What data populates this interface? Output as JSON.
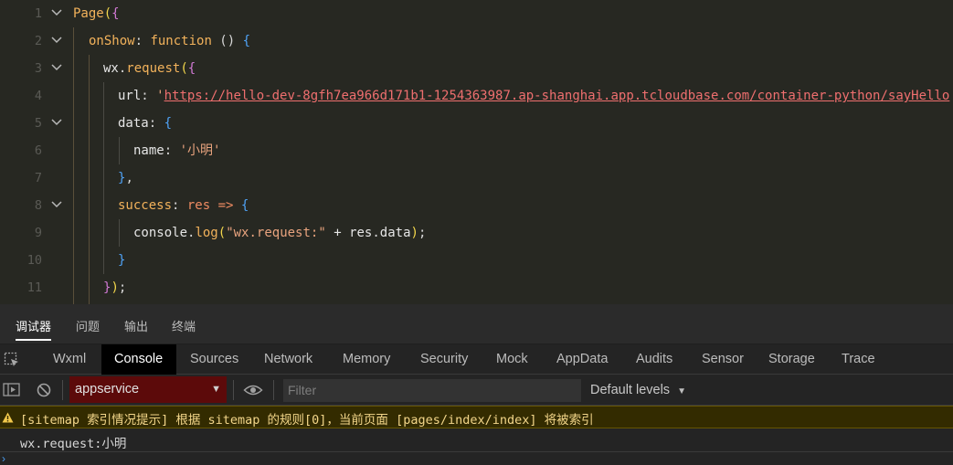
{
  "editor": {
    "lines": [
      {
        "n": "1",
        "tokens": [
          [
            "Page",
            "t-call"
          ],
          [
            "(",
            "t-brace-y"
          ],
          [
            "{",
            "t-brace-p"
          ]
        ]
      },
      {
        "n": "2",
        "tokens": [
          [
            "onShow",
            "t-prop"
          ],
          [
            ": ",
            "t-punc"
          ],
          [
            "function",
            "t-fn"
          ],
          [
            " () ",
            "t-punc"
          ],
          [
            "{",
            "t-brace-b"
          ]
        ]
      },
      {
        "n": "3",
        "tokens": [
          [
            "wx",
            "t-white"
          ],
          [
            ".",
            "t-punc"
          ],
          [
            "request",
            "t-call"
          ],
          [
            "(",
            "t-brace-y"
          ],
          [
            "{",
            "t-brace-p"
          ]
        ]
      },
      {
        "n": "4",
        "tokens": [
          [
            "url",
            "t-white"
          ],
          [
            ": ",
            "t-punc"
          ],
          [
            "'",
            "t-str"
          ],
          [
            "https://hello-dev-8gfh7ea966d171b1-1254363987.ap-shanghai.app.tcloudbase.com/container-python/sayHello",
            "t-url"
          ],
          [
            "'",
            "t-str"
          ],
          [
            ",",
            "t-punc"
          ]
        ]
      },
      {
        "n": "5",
        "tokens": [
          [
            "data",
            "t-white"
          ],
          [
            ": ",
            "t-punc"
          ],
          [
            "{",
            "t-brace-b"
          ]
        ]
      },
      {
        "n": "6",
        "tokens": [
          [
            "name",
            "t-white"
          ],
          [
            ": ",
            "t-punc"
          ],
          [
            "'小明'",
            "t-str"
          ]
        ]
      },
      {
        "n": "7",
        "tokens": [
          [
            "}",
            "t-brace-b"
          ],
          [
            ",",
            "t-punc"
          ]
        ]
      },
      {
        "n": "8",
        "tokens": [
          [
            "success",
            "t-prop"
          ],
          [
            ": ",
            "t-punc"
          ],
          [
            "res",
            "t-var"
          ],
          [
            " => ",
            "t-var"
          ],
          [
            "{",
            "t-brace-b"
          ]
        ]
      },
      {
        "n": "9",
        "tokens": [
          [
            "console",
            "t-white"
          ],
          [
            ".",
            "t-punc"
          ],
          [
            "log",
            "t-log"
          ],
          [
            "(",
            "t-brace-y"
          ],
          [
            "\"wx.request:\"",
            "t-str"
          ],
          [
            " + ",
            "t-white"
          ],
          [
            "res",
            "t-white"
          ],
          [
            ".",
            "t-punc"
          ],
          [
            "data",
            "t-white"
          ],
          [
            ")",
            "t-brace-y"
          ],
          [
            ";",
            "t-punc"
          ]
        ]
      },
      {
        "n": "10",
        "tokens": [
          [
            "}",
            "t-brace-b"
          ]
        ]
      },
      {
        "n": "11",
        "tokens": [
          [
            "}",
            "t-brace-p"
          ],
          [
            ")",
            "t-brace-y"
          ],
          [
            ";",
            "t-punc"
          ]
        ]
      }
    ]
  },
  "panel_tabs": [
    "调试器",
    "问题",
    "输出",
    "终端"
  ],
  "tool_tabs": [
    "Wxml",
    "Console",
    "Sources",
    "Network",
    "Memory",
    "Security",
    "Mock",
    "AppData",
    "Audits",
    "Sensor",
    "Storage",
    "Trace"
  ],
  "console": {
    "context": "appservice",
    "filter_placeholder": "Filter",
    "levels": "Default levels",
    "warning": "[sitemap 索引情况提示] 根据 sitemap 的规则[0]，当前页面 [pages/index/index] 将被索引",
    "log": "wx.request:小明",
    "prompt": "›"
  }
}
